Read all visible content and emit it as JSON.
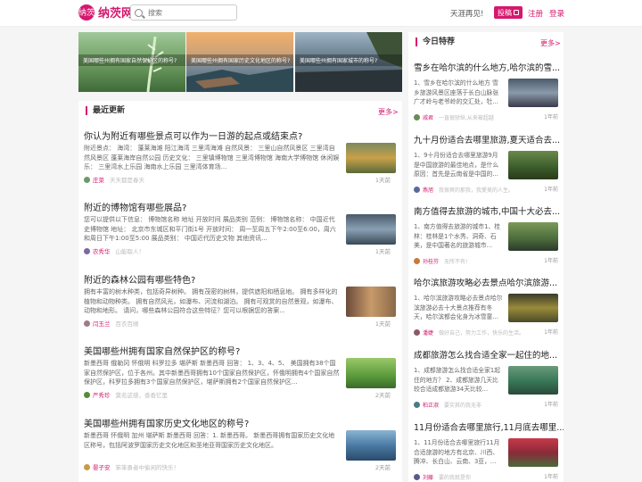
{
  "header": {
    "logo_mark": "纳茨",
    "site_name": "纳茨网",
    "search_placeholder": "搜索",
    "greeting": "天涯再见!",
    "submit_label": "投稿",
    "register_label": "注册",
    "login_label": "登录"
  },
  "banners": [
    {
      "caption": "美国哪些州拥有国家自然保护区的称号?"
    },
    {
      "caption": "美国哪些州拥有国家历史文化地区的称号?"
    },
    {
      "caption": "美国哪些州拥有国家城市的称号?"
    }
  ],
  "latest": {
    "title": "最近更新",
    "more": "更多>",
    "articles": [
      {
        "title": "你认为附近有哪些景点可以作为一日游的起点或结束点?",
        "body": "附近景点： 海湾： 蓬莱海滩 阳江海湾 三里湾海滩 自然风景： 三里山自然风景区 三里湾自然风景区 蓬莱海岸自然公园 历史文化： 三里镇博物馆 三里湾博物馆 海南大学博物馆 休闲娱乐： 三里湾水上乐园 海南水上乐园 三里湾体育场...",
        "author": "庄菜",
        "sig": "天天都是春天",
        "time": "1天前"
      },
      {
        "title": "附近的博物馆有哪些展品?",
        "body": "您可以提供以下信息： 博物馆名称 地址 开放时间 展品类别 范例： 博物馆名称： 中国近代史博物馆 地址： 北京市东城区和平门街1号 开放时间： 周一至周五下午2:00至6:00，周六和周日下午1:00至5:00 展品类别： 中国近代历史文物 其他资讯...",
        "author": "农秀华",
        "sig": "山能取人！",
        "time": "1天前"
      },
      {
        "title": "附近的森林公园有哪些特色?",
        "body": "拥有丰富的树木种类，包括奇异树种。 拥有茂密的树林，提供遮阳和栖息地。 拥有多样化的植物和动物种类。 拥有自然风光，如瀑布、河流和湖泊。 拥有可观赏的自然景观，如瀑布、动物和地形。 请问，哪些森林公园符合这些特征？您可以根据您的答案...",
        "author": "闫玉兰",
        "sig": "百衣百顺",
        "time": "1天前"
      },
      {
        "title": "美国哪些州拥有国家自然保护区的称号?",
        "body": "新墨西哥 俄勒冈 怀俄明 科罗拉多 堪萨斯 新墨西哥 回答： 1、3、4、5、 美国拥有38个国家自然保护区，位于各州。其中新墨西哥拥有10个国家自然保护区，怀俄明拥有4个国家自然保护区，科罗拉多拥有3个国家自然保护区，堪萨斯拥有2个国家自然保护区...",
        "author": "严秀珍",
        "sig": "莫名这感，香香忆里",
        "time": "2天前"
      },
      {
        "title": "美国哪些州拥有国家历史文化地区的称号?",
        "body": "新墨西哥 怀俄明 加州 堪萨斯 新墨西哥 回答：1. 新墨西哥。 新墨西哥拥有国家历史文化地区称号，包括阿波罗国家历史文化地区和圣地亚哥国家历史文化地区。",
        "author": "晏子安",
        "sig": "笨笨勇者中偷闲的快乐！",
        "time": "2天前"
      }
    ]
  },
  "today": {
    "title": "今日特荐",
    "more": "更多>",
    "items": [
      {
        "title": "雪乡在哈尔滨的什么地方,哈尔滨的雪...",
        "body": "1、雪乡在哈尔滨的什么地方 雪乡旅游风景区座落于长白山脉张广才岭与老爷岭的交汇处，牡...",
        "author": "戚君",
        "sig": "一直很骄纵,从来被超越",
        "time": "1年前"
      },
      {
        "title": "九十月份适合去哪里旅游,夏天适合去...",
        "body": "1、9十月份适合去哪里旅游9月是中国旅游的最佳地点，是什么原因：首先是云南省是中国的...",
        "author": "燕旭",
        "sig": "我很爽的那我，我愛美的人生。",
        "time": "1年前"
      },
      {
        "title": "南方值得去旅游的城市,中国十大必去...",
        "body": "1、南方值得去旅游的城市1、桂林：桂林是1个水秀、洞奇、石美，是中国著名的旅游城市...",
        "author": "孙桂芬",
        "sig": "无所不有!",
        "time": "1年前"
      },
      {
        "title": "哈尔滨旅游攻略必去景点哈尔滨旅游...",
        "body": "1、哈尔滨旅游攻略必去景点哈尔滨旅游必去十大景点推荐有冬天，哈尔滨都会化身为冰雪童...",
        "author": "潘婕",
        "sig": "做好自己，努力工作，快乐的生活。",
        "time": "1年前"
      },
      {
        "title": "成都旅游怎么找合适全家一起住的地...",
        "body": "1、成都旅游怎么找合适全家1起住的地方？ 2、成都旅游几天比较合适成都旅游34天比较...",
        "author": "柏正淑",
        "sig": "要实其的我无非",
        "time": "1年前"
      },
      {
        "title": "11月份适合去哪里旅行,11月底去哪里...",
        "body": "1、11月份适合去哪里旅行11月合适旅游的地方有北京、川西、腾冲、长白山、云南、3亚，...",
        "author": "刘藤",
        "sig": "要的我就是你",
        "time": "1年前"
      }
    ]
  },
  "colors": {
    "accent": "#d6186f",
    "background": "#f5f5f5"
  }
}
